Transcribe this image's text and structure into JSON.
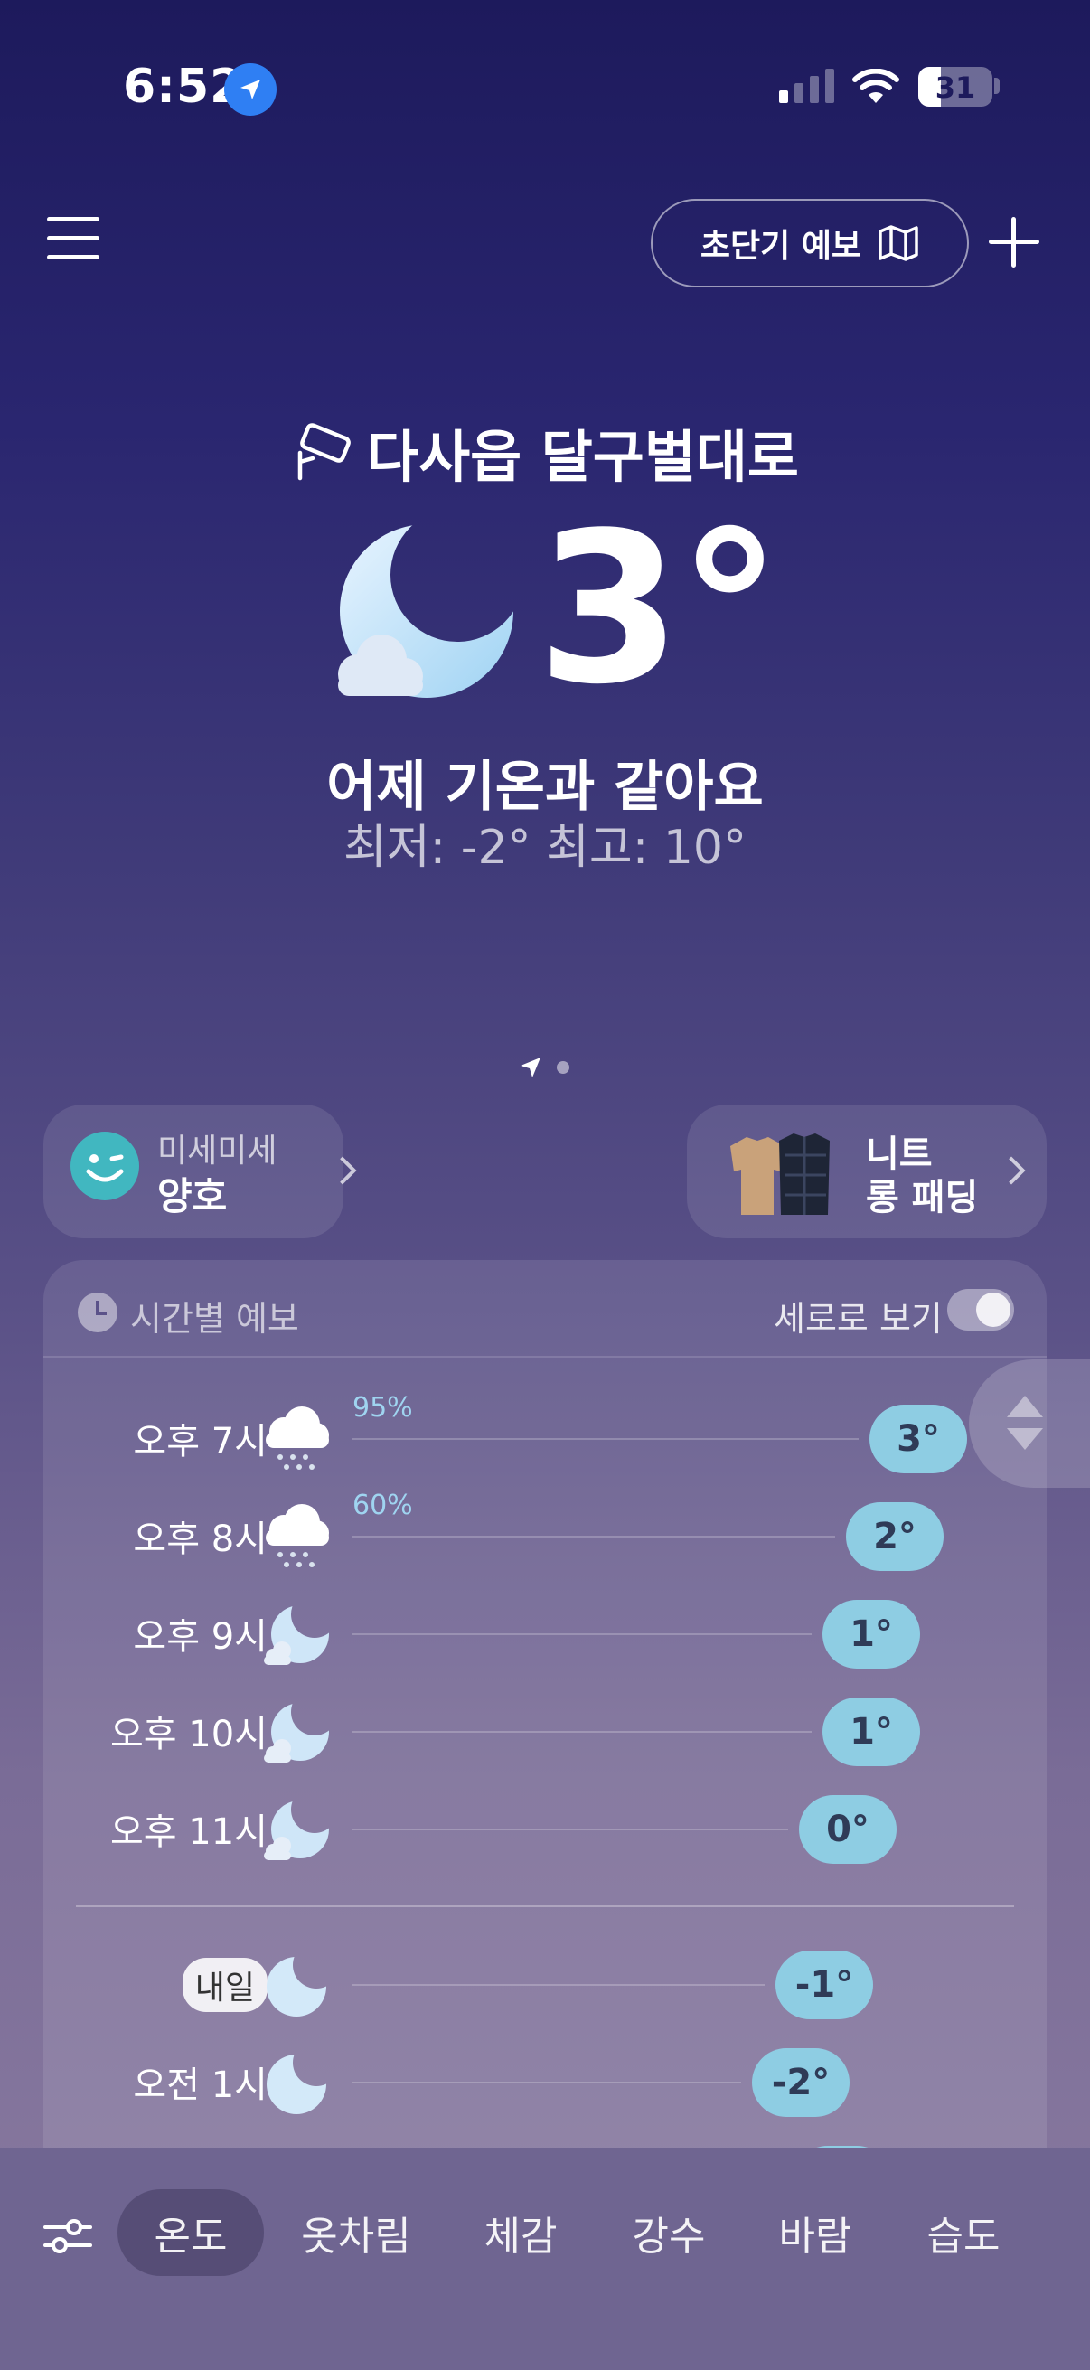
{
  "status_bar": {
    "time": "6:52",
    "battery": "31",
    "battery_level": 0.31
  },
  "top_bar": {
    "forecast_button": "초단기 예보"
  },
  "hero": {
    "location": "다사읍 달구벌대로",
    "temperature": "3°",
    "condition_icon": "crescent-moon-cloud-icon",
    "comparison": "어제 기온과 같아요",
    "range": "최저: -2°  최고: 10°"
  },
  "page_indicator": {
    "count": 2,
    "active": 0
  },
  "dust_card": {
    "label": "미세미세",
    "value": "양호",
    "icon": "smile-face-icon"
  },
  "clothing_card": {
    "line1": "니트",
    "line2": "롱 패딩",
    "icon": "clothes-icon"
  },
  "hourly": {
    "title": "시간별 예보",
    "vertical_view_label": "세로로 보기",
    "vertical_view_on": true,
    "rows": [
      {
        "time": "오후 7시",
        "icon": "snow-cloud-icon",
        "precip": "95%",
        "temp": "3°",
        "value": 3
      },
      {
        "time": "오후 8시",
        "icon": "snow-cloud-icon",
        "precip": "60%",
        "temp": "2°",
        "value": 2
      },
      {
        "time": "오후 9시",
        "icon": "moon-cloud-icon",
        "precip": "",
        "temp": "1°",
        "value": 1
      },
      {
        "time": "오후 10시",
        "icon": "moon-cloud-icon",
        "precip": "",
        "temp": "1°",
        "value": 1
      },
      {
        "time": "오후 11시",
        "icon": "moon-cloud-icon",
        "precip": "",
        "temp": "0°",
        "value": 0
      },
      {
        "time": "내일",
        "icon": "moon-icon",
        "precip": "",
        "temp": "-1°",
        "value": -1,
        "badge": true
      },
      {
        "time": "오전 1시",
        "icon": "moon-icon",
        "precip": "",
        "temp": "-2°",
        "value": -2
      }
    ]
  },
  "tabs": [
    "온도",
    "옷차림",
    "체감",
    "강수",
    "바람",
    "습도"
  ],
  "active_tab": 0,
  "colors": {
    "temp_pill": "#8ecde3",
    "location_dot": "#2f7ff3",
    "dust_face": "#41b7c0"
  }
}
